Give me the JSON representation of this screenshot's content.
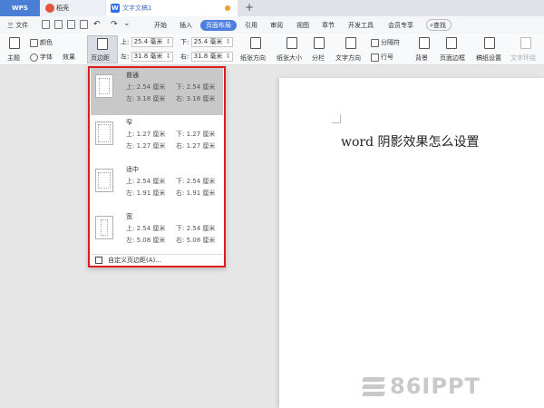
{
  "tabs": {
    "wps": "WPS",
    "daoke": "稻壳",
    "doc": "文字文稿1",
    "add": "+"
  },
  "menu": {
    "file": "三 文件",
    "items": [
      "开始",
      "插入",
      "页面布局",
      "引用",
      "审阅",
      "视图",
      "章节",
      "开发工具",
      "会员专享"
    ],
    "active": "页面布局",
    "search": "查找"
  },
  "ribbon": {
    "theme": "主题",
    "color": "颜色",
    "font": "字体",
    "effect": "效果",
    "margin_btn": "页边距",
    "top_label": "上:",
    "top_val": "25.4 毫米",
    "bottom_label": "下:",
    "bottom_val": "25.4 毫米",
    "left_label": "左:",
    "left_val": "31.8 毫米",
    "right_label": "右:",
    "right_val": "31.8 毫米",
    "orientation": "纸张方向",
    "size": "纸张大小",
    "columns": "分栏",
    "text_direction": "文字方向",
    "break": "分隔符",
    "line_num": "行号",
    "background": "背景",
    "border": "页面边框",
    "grid_setting": "稿纸设置",
    "wrap": "文字环绕"
  },
  "dropdown": {
    "options": [
      {
        "name": "普通",
        "top": "上: 2.54 厘米",
        "bottom": "下: 2.54 厘米",
        "left": "左: 3.18 厘米",
        "right": "右: 3.18 厘米"
      },
      {
        "name": "窄",
        "top": "上: 1.27 厘米",
        "bottom": "下: 1.27 厘米",
        "left": "左: 1.27 厘米",
        "right": "右: 1.27 厘米"
      },
      {
        "name": "适中",
        "top": "上: 2.54 厘米",
        "bottom": "下: 2.54 厘米",
        "left": "左: 1.91 厘米",
        "right": "右: 1.91 厘米"
      },
      {
        "name": "宽",
        "top": "上: 2.54 厘米",
        "bottom": "下: 2.54 厘米",
        "left": "左: 5.08 厘米",
        "right": "右: 5.08 厘米"
      }
    ],
    "custom": "自定义页边距(A)..."
  },
  "document": {
    "text": "word 阴影效果怎么设置"
  },
  "watermark": "86IPPT",
  "colors": {
    "accent": "#4e7fe0",
    "highlight_border": "#e01b1b"
  }
}
